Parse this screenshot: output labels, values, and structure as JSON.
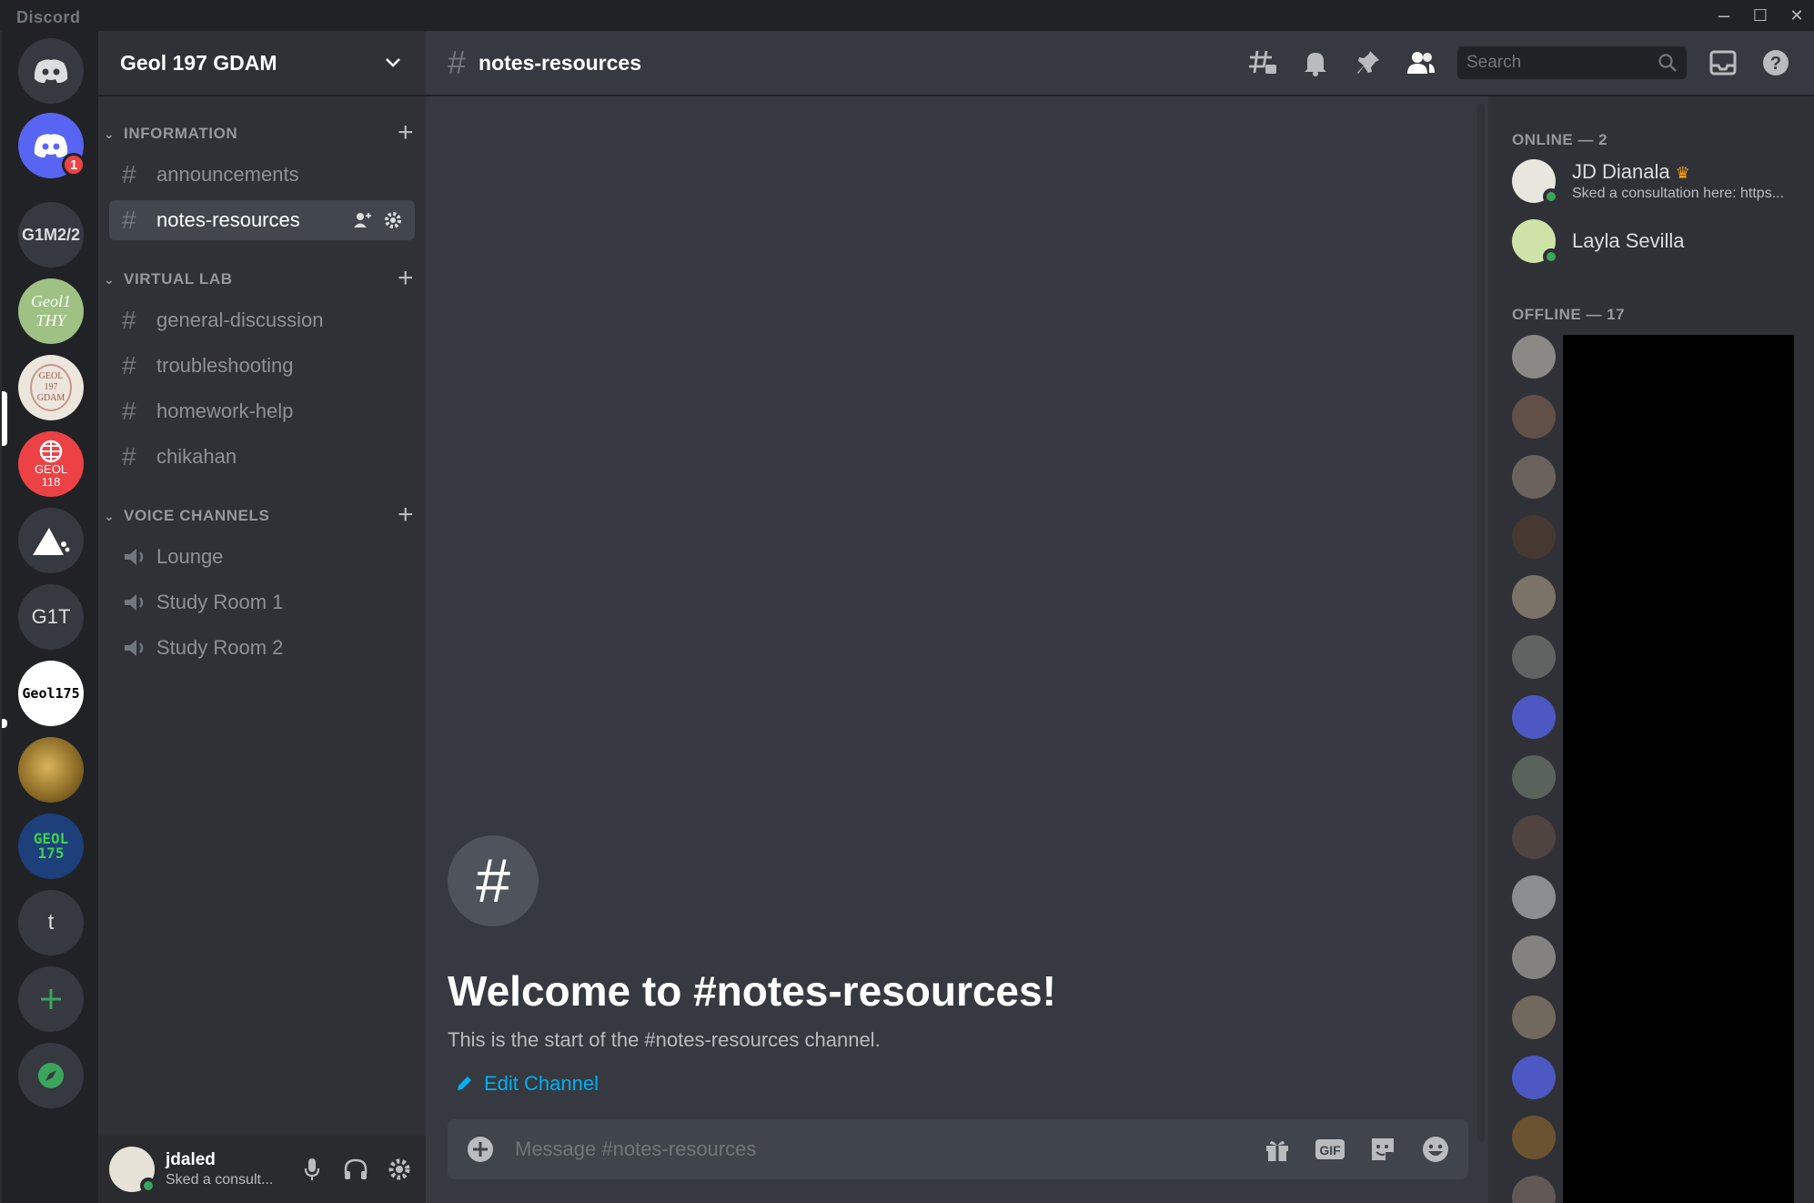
{
  "window": {
    "brand": "Discord",
    "minimize": "–",
    "maximize": "☐",
    "close": "✕"
  },
  "rail": {
    "servers": [
      {
        "label": "G1M2/2"
      },
      {
        "label": "Geol1 THY"
      },
      {
        "label": "GEOL 197 GDAM"
      },
      {
        "label": "GEOL 118"
      },
      {
        "label": "G1T"
      },
      {
        "label": "Geol175"
      },
      {
        "label": "GEOL 175"
      },
      {
        "label": "t"
      }
    ],
    "home_badge": "1"
  },
  "guild": {
    "name": "Geol 197 GDAM"
  },
  "categories": [
    {
      "label": "INFORMATION"
    },
    {
      "label": "VIRTUAL LAB"
    },
    {
      "label": "VOICE CHANNELS"
    }
  ],
  "channels": {
    "information": [
      "announcements",
      "notes-resources"
    ],
    "virtual_lab": [
      "general-discussion",
      "troubleshooting",
      "homework-help",
      "chikahan"
    ],
    "voice": [
      "Lounge",
      "Study Room 1",
      "Study Room 2"
    ]
  },
  "user": {
    "name": "jdaled",
    "status": "Sked a consult..."
  },
  "header": {
    "channel": "notes-resources",
    "search_placeholder": "Search"
  },
  "welcome": {
    "title": "Welcome to #notes-resources!",
    "subtitle": "This is the start of the #notes-resources channel.",
    "edit_label": "Edit Channel"
  },
  "composer": {
    "placeholder": "Message #notes-resources",
    "gif_label": "GIF"
  },
  "members": {
    "online_header": "ONLINE — 2",
    "offline_header": "OFFLINE — 17",
    "online": [
      {
        "name": "JD Dianala",
        "status": "Sked a consultation here: https..."
      },
      {
        "name": "Layla Sevilla",
        "status": ""
      }
    ]
  },
  "colors": {
    "accent": "#5865f2",
    "online": "#3ba55d",
    "link": "#00aff4",
    "danger": "#ed4245"
  }
}
